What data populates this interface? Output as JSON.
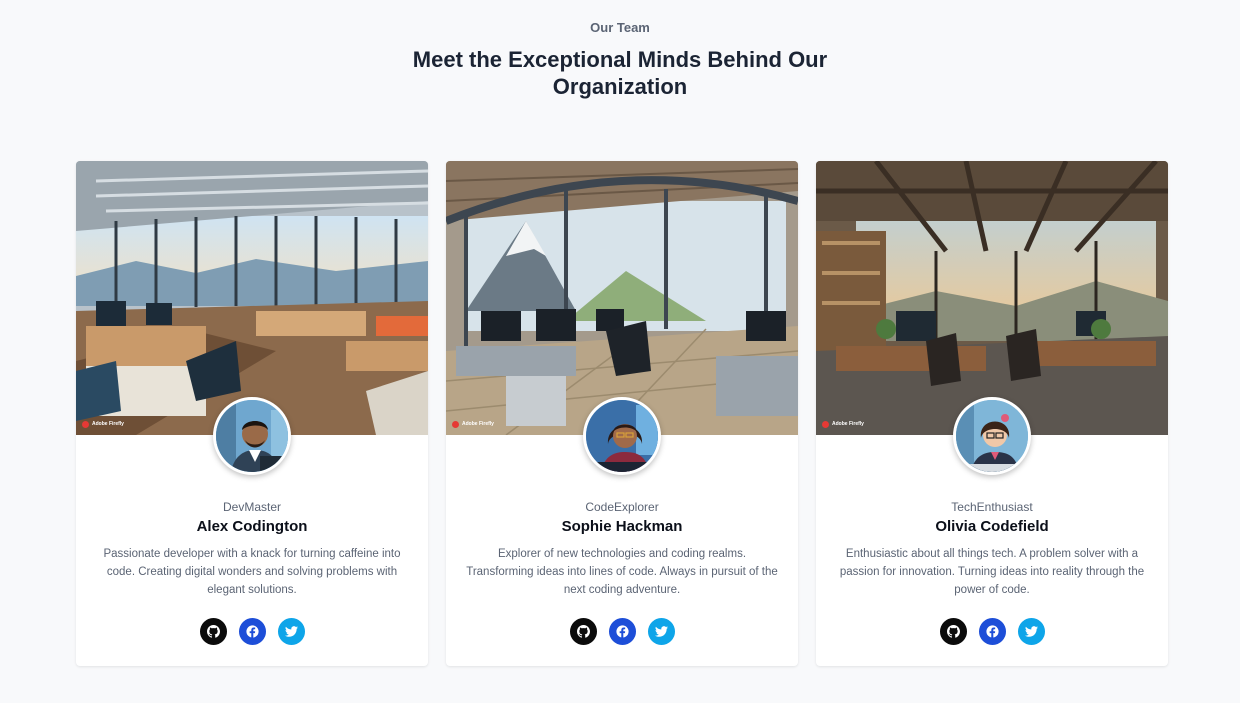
{
  "header": {
    "eyebrow": "Our Team",
    "title_line1": "Meet the Exceptional Minds Behind Our",
    "title_line2": "Organization"
  },
  "badge_label": "Adobe Firefly",
  "colors": {
    "github": "#0b0b0b",
    "facebook": "#1d4ed8",
    "twitter": "#0ea5e9"
  },
  "members": [
    {
      "handle": "DevMaster",
      "name": "Alex Codington",
      "bio": "Passionate developer with a knack for turning caffeine into code. Creating digital wonders and solving problems with elegant solutions.",
      "social": [
        "github-icon",
        "facebook-icon",
        "twitter-icon"
      ]
    },
    {
      "handle": "CodeExplorer",
      "name": "Sophie Hackman",
      "bio": "Explorer of new technologies and coding realms. Transforming ideas into lines of code. Always in pursuit of the next coding adventure.",
      "social": [
        "github-icon",
        "facebook-icon",
        "twitter-icon"
      ]
    },
    {
      "handle": "TechEnthusiast",
      "name": "Olivia Codefield",
      "bio": "Enthusiastic about all things tech. A problem solver with a passion for innovation. Turning ideas into reality through the power of code.",
      "social": [
        "github-icon",
        "facebook-icon",
        "twitter-icon"
      ]
    }
  ]
}
